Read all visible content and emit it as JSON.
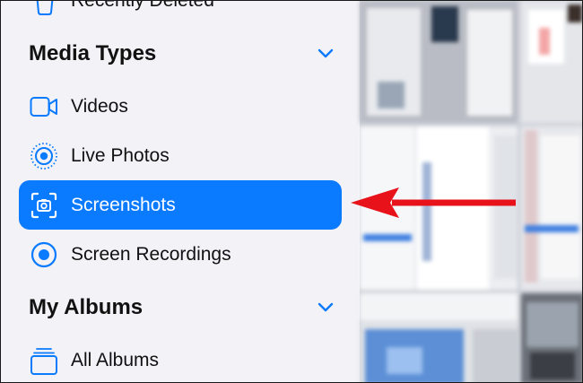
{
  "sidebar": {
    "recently_deleted_label": "Recently Deleted",
    "media_types": {
      "title": "Media Types",
      "items": [
        {
          "label": "Videos",
          "icon": "video-camera-icon"
        },
        {
          "label": "Live Photos",
          "icon": "live-photo-icon"
        },
        {
          "label": "Screenshots",
          "icon": "screenshot-icon",
          "selected": true
        },
        {
          "label": "Screen Recordings",
          "icon": "screen-recording-icon"
        }
      ]
    },
    "my_albums": {
      "title": "My Albums",
      "items": [
        {
          "label": "All Albums",
          "icon": "albums-stack-icon"
        }
      ]
    }
  },
  "colors": {
    "accent": "#0a7aff",
    "sidebar_bg": "#f2f2f7",
    "arrow": "#e8121b"
  }
}
